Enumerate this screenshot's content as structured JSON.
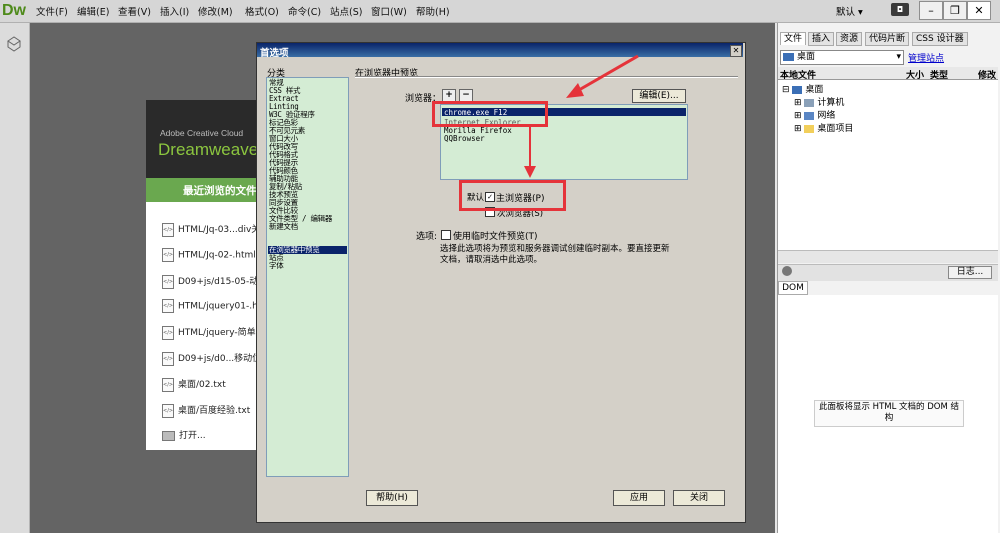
{
  "app": {
    "logo": "Dw",
    "menus": [
      "文件(F)",
      "编辑(E)",
      "查看(V)",
      "插入(I)",
      "修改(M)",
      "格式(O)",
      "命令(C)",
      "站点(S)",
      "窗口(W)",
      "帮助(H)"
    ],
    "layout_selector": "默认 ▾",
    "sys_button": "◘"
  },
  "window_buttons": {
    "minimize": "–",
    "restore": "❐",
    "close": "✕"
  },
  "welcome": {
    "adobe": "Adobe Creative Cloud",
    "product": "Dreamweaver",
    "recent_title": "最近浏览的文件",
    "recent_files": [
      "HTML/Jq-03...div关注",
      "HTML/Jq-02-.html",
      "D09+js/d15-05-动画",
      "HTML/jquery01-.html",
      "HTML/jquery-简单用",
      "D09+js/d0...移动位置",
      "桌面/02.txt",
      "桌面/百度经验.txt"
    ],
    "open_label": "打开..."
  },
  "right_panel": {
    "tabs": [
      "文件",
      "插入",
      "资源",
      "代码片断",
      "CSS 设计器"
    ],
    "site_select": "桌面",
    "manage_sites": "管理站点",
    "columns": [
      "本地文件",
      "大小",
      "类型",
      "修改"
    ],
    "tree": [
      {
        "label": "桌面",
        "level": 0
      },
      {
        "label": "计算机",
        "level": 1
      },
      {
        "label": "网络",
        "level": 1
      },
      {
        "label": "桌面项目",
        "level": 1
      }
    ],
    "log_button": "日志...",
    "dom_tab": "DOM",
    "dom_message": "此面板将显示 HTML 文档的 DOM 结构"
  },
  "dialog": {
    "title": "首选项",
    "category_label": "分类",
    "categories": [
      "常规",
      "CSS 样式",
      "Extract",
      "Linting",
      "W3C 验证程序",
      "标记色彩",
      "不可见元素",
      "窗口大小",
      "代码改写",
      "代码格式",
      "代码提示",
      "代码颜色",
      "辅助功能",
      "复制/粘贴",
      "技术预览",
      "同步设置",
      "文件比较",
      "文件类型 / 编辑器",
      "新建文档",
      "在浏览器中预览",
      "站点",
      "字体"
    ],
    "selected_category": "在浏览器中预览",
    "section_title": "在浏览器中预览",
    "browser_label": "浏览器：",
    "add_btn": "+",
    "remove_btn": "−",
    "edit_btn": "编辑(E)...",
    "browsers": [
      "chrome.exe    F12",
      "Internet Explorer",
      "Morilla Firefox",
      "QQBrowser"
    ],
    "default_label": "默认:",
    "primary_browser": "主浏览器(P)",
    "secondary_browser": "次浏览器(S)",
    "primary_checked": true,
    "secondary_checked": false,
    "options_label": "选项:",
    "temp_file_label": "使用临时文件预览(T)",
    "description_line1": "选择此选项将为预览和服务器调试创建临时副本。要直接更新",
    "description_line2": "文档，请取消选中此选项。",
    "help_btn": "帮助(H)",
    "apply_btn": "应用",
    "close_btn": "关闭"
  },
  "colors": {
    "annotation_red": "#e5333a",
    "list_bg": "#d4ecd4",
    "selection": "#0a246a",
    "dw_green": "#8cc63f"
  }
}
